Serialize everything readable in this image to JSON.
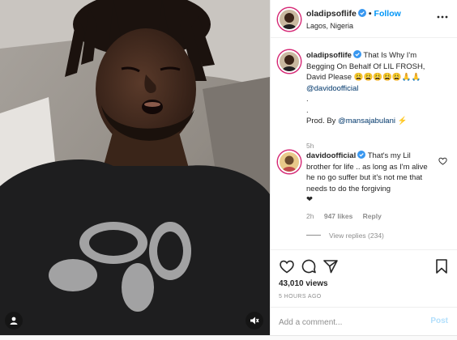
{
  "post": {
    "username": "oladipsoflife",
    "follow_label": "Follow",
    "location": "Lagos, Nigeria"
  },
  "caption": {
    "username": "oladipsoflife",
    "text_line1": "That Is Why I'm",
    "text_line2": "Begging On Behalf Of LIL FROSH,",
    "text_line3": "David Please 😩😩😩😩😩🙏🙏",
    "mention": "@davidoofficial",
    "dot1": ".",
    "dot2": ".",
    "prod_prefix": "Prod. By",
    "prod_mention": "@mansajabulani",
    "prod_suffix": "⚡",
    "time": "5h"
  },
  "comment": {
    "username": "davidoofficial",
    "text": "That's my Lil brother for life .. as long as I'm alive he no go suffer but it's not me that needs to do the forgiving",
    "emoji": "❤",
    "time": "2h",
    "likes": "947 likes",
    "reply_label": "Reply",
    "view_replies": "View replies (234)"
  },
  "actions": {
    "views": "43,010 views",
    "posted_ago": "5 HOURS AGO",
    "comment_placeholder": "Add a comment...",
    "post_label": "Post"
  },
  "colors": {
    "link_blue": "#0095f6",
    "story_ring": "#d62976",
    "post_disabled": "#b2dffc"
  },
  "icons": [
    "verified-badge-icon",
    "more-options-icon",
    "heart-icon",
    "comment-icon",
    "share-icon",
    "bookmark-icon",
    "user-tag-icon",
    "muted-speaker-icon"
  ]
}
